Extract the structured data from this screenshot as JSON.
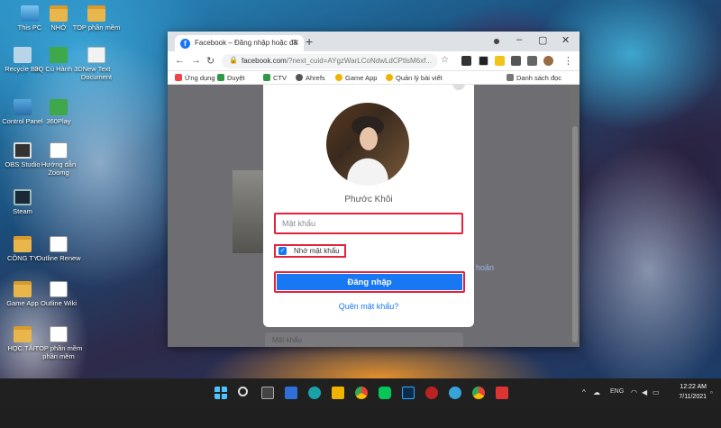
{
  "desktop": {
    "icons": [
      {
        "label": "This PC"
      },
      {
        "label": "NHỚ"
      },
      {
        "label": "TOP phần mềm"
      },
      {
        "label": "Recycle Bin"
      },
      {
        "label": "3Q Củ Hành 3D"
      },
      {
        "label": "New Text Document"
      },
      {
        "label": "Control Panel"
      },
      {
        "label": "360Play"
      },
      {
        "label": "OBS Studio"
      },
      {
        "label": "Hướng dẫn Zoomg"
      },
      {
        "label": "Steam"
      },
      {
        "label": "CÔNG TY"
      },
      {
        "label": "Outline Renew"
      },
      {
        "label": "Game App"
      },
      {
        "label": "Outline Wiki"
      },
      {
        "label": "HỌC TẬP"
      },
      {
        "label": "TOP phần mềm phần mềm"
      }
    ]
  },
  "browser": {
    "tab_title": "Facebook – Đăng nhập hoặc đă",
    "tab_favicon": "f",
    "url_host": "facebook.com",
    "url_path": "/?next_cuid=AYgzWarLCoNdwLdCPtlsM6xf...",
    "bookmarks": [
      {
        "label": "Ứng dụng",
        "color": "#e44"
      },
      {
        "label": "Duyệt",
        "color": "#2e9a46"
      },
      {
        "label": "CTV",
        "color": "#2e9a46"
      },
      {
        "label": "Ahrefs",
        "color": "#555"
      },
      {
        "label": "Game App",
        "color": "#f0b400"
      },
      {
        "label": "Quản lý bài viết",
        "color": "#f0b400"
      }
    ],
    "reading_list": "Danh sách đọc"
  },
  "login": {
    "profile_name": "Phước Khôi",
    "password_placeholder": "Mật khẩu",
    "remember_label": "Nhớ mật khẩu",
    "remember_checked": true,
    "login_button": "Đăng nhập",
    "forgot_link": "Quên mật khẩu?"
  },
  "background_page": {
    "link_fragment": "hoản",
    "field_placeholder": "Mật khẩu"
  },
  "taskbar": {
    "language": "ENG",
    "time": "12:22 AM",
    "date": "7/11/2021"
  },
  "colors": {
    "facebook_blue": "#1877f2",
    "highlight_red": "#e4223b"
  }
}
